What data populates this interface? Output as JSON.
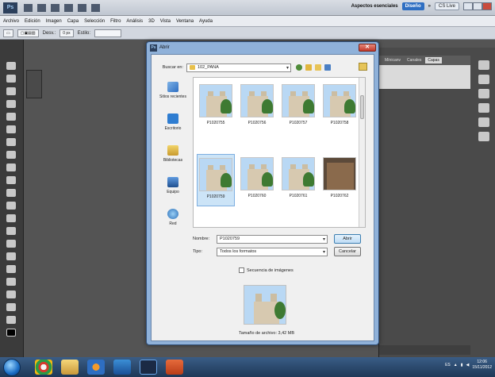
{
  "ps": {
    "logo": "Ps",
    "workspace_label": "Aspectos esenciales",
    "workspace_active": "Diseño",
    "more": "»",
    "cslive": "CS Live"
  },
  "menu": [
    "Archivo",
    "Edición",
    "Imagen",
    "Capa",
    "Selección",
    "Filtro",
    "Análisis",
    "3D",
    "Vista",
    "Ventana",
    "Ayuda"
  ],
  "options": {
    "feather_label": "Desv.:",
    "feather_value": "0 px",
    "style_label": "Estilo:"
  },
  "right_panel": {
    "tabs": [
      "Mínicanv",
      "Canales",
      "Capas"
    ],
    "active_tab": "Capas"
  },
  "dialog": {
    "title": "Abrir",
    "look_in_label": "Buscar en:",
    "look_in_value": "102_PANA",
    "places": [
      {
        "label": "Sitios recientes",
        "icon": "recent-places-icon"
      },
      {
        "label": "Escritorio",
        "icon": "desktop-icon"
      },
      {
        "label": "Bibliotecas",
        "icon": "libraries-icon"
      },
      {
        "label": "Equipo",
        "icon": "computer-icon"
      },
      {
        "label": "Red",
        "icon": "network-icon"
      }
    ],
    "files": [
      {
        "name": "P1020755",
        "kind": "exterior"
      },
      {
        "name": "P1020756",
        "kind": "exterior"
      },
      {
        "name": "P1020757",
        "kind": "exterior"
      },
      {
        "name": "P1020758",
        "kind": "exterior"
      },
      {
        "name": "P1020759",
        "kind": "exterior"
      },
      {
        "name": "P1020760",
        "kind": "exterior"
      },
      {
        "name": "P1020761",
        "kind": "exterior"
      },
      {
        "name": "P1020762",
        "kind": "interior"
      }
    ],
    "selected_file": "P1020759",
    "name_label": "Nombre:",
    "name_value": "P1020759",
    "type_label": "Tipo:",
    "type_value": "Todos los formatos",
    "open_button": "Abrir",
    "cancel_button": "Cancelar",
    "sequence_label": "Secuencia de imágenes",
    "file_size": "Tamaño de archivo: 3,42 MB"
  },
  "taskbar": {
    "language": "ES",
    "time": "12:06",
    "date": "15/11/2012"
  }
}
